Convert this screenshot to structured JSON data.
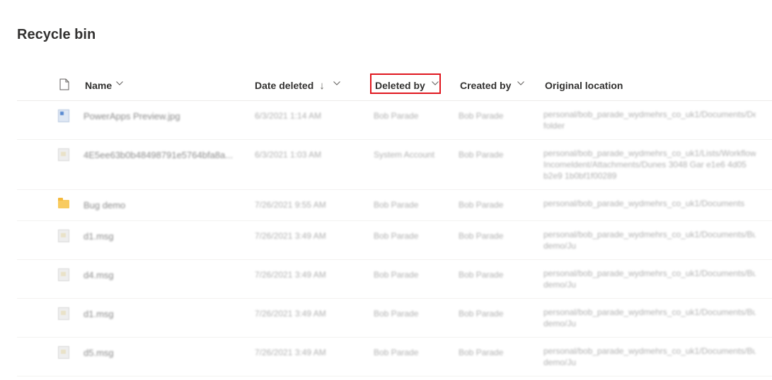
{
  "page": {
    "title": "Recycle bin"
  },
  "columns": {
    "name": "Name",
    "date_deleted": "Date deleted",
    "date_deleted_sort": "↓",
    "deleted_by": "Deleted by",
    "created_by": "Created by",
    "original_location": "Original location"
  },
  "highlight_color": "#e0161e",
  "rows": [
    {
      "icon": "image-file-icon",
      "name": "PowerApps Preview.jpg",
      "date_deleted": "6/3/2021 1:14 AM",
      "deleted_by": "Bob Parade",
      "created_by": "Bob Parade",
      "location": "personal/bob_parade_wydmehrs_co_uk1/Documents/Desktop/New folder"
    },
    {
      "icon": "document-file-icon",
      "name": "4E5ee63b0b48498791e5764bfa8a...",
      "date_deleted": "6/3/2021 1:03 AM",
      "deleted_by": "System Account",
      "created_by": "Bob Parade",
      "location": "personal/bob_parade_wydmehrs_co_uk1/Lists/Workflow Incomeldent/Attachments/Dunes 3048 Gar e1e6 4d05 b2e9 1b0bf1f00289"
    },
    {
      "icon": "folder-icon",
      "name": "Bug demo",
      "date_deleted": "7/26/2021 9:55 AM",
      "deleted_by": "Bob Parade",
      "created_by": "Bob Parade",
      "location": "personal/bob_parade_wydmehrs_co_uk1/Documents"
    },
    {
      "icon": "document-file-icon",
      "name": "d1.msg",
      "date_deleted": "7/26/2021 3:49 AM",
      "deleted_by": "Bob Parade",
      "created_by": "Bob Parade",
      "location": "personal/bob_parade_wydmehrs_co_uk1/Documents/Bu demo/Ju"
    },
    {
      "icon": "document-file-icon",
      "name": "d4.msg",
      "date_deleted": "7/26/2021 3:49 AM",
      "deleted_by": "Bob Parade",
      "created_by": "Bob Parade",
      "location": "personal/bob_parade_wydmehrs_co_uk1/Documents/Bu demo/Ju"
    },
    {
      "icon": "document-file-icon",
      "name": "d1.msg",
      "date_deleted": "7/26/2021 3:49 AM",
      "deleted_by": "Bob Parade",
      "created_by": "Bob Parade",
      "location": "personal/bob_parade_wydmehrs_co_uk1/Documents/Bu demo/Ju"
    },
    {
      "icon": "document-file-icon",
      "name": "d5.msg",
      "date_deleted": "7/26/2021 3:49 AM",
      "deleted_by": "Bob Parade",
      "created_by": "Bob Parade",
      "location": "personal/bob_parade_wydmehrs_co_uk1/Documents/Bu demo/Ju"
    }
  ]
}
